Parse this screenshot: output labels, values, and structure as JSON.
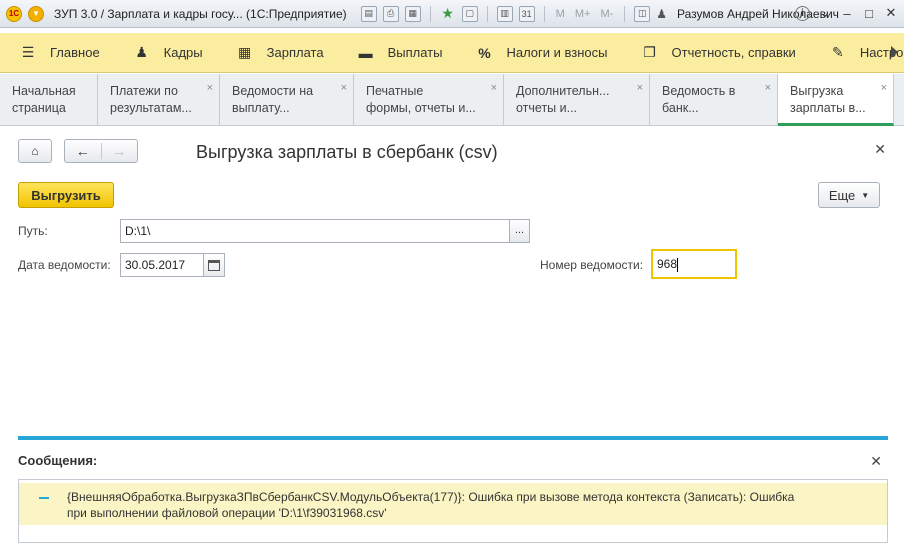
{
  "window": {
    "title": "ЗУП 3.0 / Зарплата и кадры госу...  (1С:Предприятие)",
    "logo": "1С",
    "user": "Разумов Андрей Николаевич",
    "toolbar": {
      "m": "M",
      "m_plus": "M+",
      "m_minus": "M-"
    }
  },
  "sections": [
    {
      "icon": "menu-lines-icon",
      "label": "Главное"
    },
    {
      "icon": "people-icon",
      "label": "Кадры"
    },
    {
      "icon": "calculator-icon",
      "label": "Зарплата"
    },
    {
      "icon": "wallet-icon",
      "label": "Выплаты"
    },
    {
      "icon": "percent-icon",
      "label": "Налоги и взносы"
    },
    {
      "icon": "documents-icon",
      "label": "Отчетность, справки"
    },
    {
      "icon": "wrench-icon",
      "label": "Настро"
    }
  ],
  "tabs": [
    {
      "line1": "Начальная",
      "line2": "страница"
    },
    {
      "line1": "Платежи по",
      "line2": "результатам..."
    },
    {
      "line1": "Ведомости на",
      "line2": "выплату..."
    },
    {
      "line1": "Печатные",
      "line2": "формы, отчеты и..."
    },
    {
      "line1": "Дополнительн...",
      "line2": "отчеты и..."
    },
    {
      "line1": "Ведомость в",
      "line2": "банк..."
    },
    {
      "line1": "Выгрузка",
      "line2": "зарплаты в..."
    }
  ],
  "form": {
    "title": "Выгрузка зарплаты в сбербанк (csv)",
    "upload_label": "Выгрузить",
    "more_label": "Еще",
    "path_label": "Путь:",
    "path_value": "D:\\1\\",
    "path_button": "...",
    "date_label": "Дата ведомости:",
    "date_value": "30.05.2017",
    "number_label": "Номер ведомости:",
    "number_value": "968"
  },
  "messages": {
    "title": "Сообщения:",
    "items": [
      {
        "line1": "{ВнешняяОбработка.ВыгрузкаЗПвСбербанкCSV.МодульОбъекта(177)}: Ошибка при вызове метода контекста (Записать): Ошибка",
        "line2": "при выполнении файловой операции  'D:\\1\\f39031968.csv'"
      }
    ]
  },
  "colors": {
    "accent_yellow": "#f0c400",
    "section_bg": "#fbeda0",
    "active_tab": "#2f9e5c",
    "messages_bar": "#28a6d8"
  }
}
